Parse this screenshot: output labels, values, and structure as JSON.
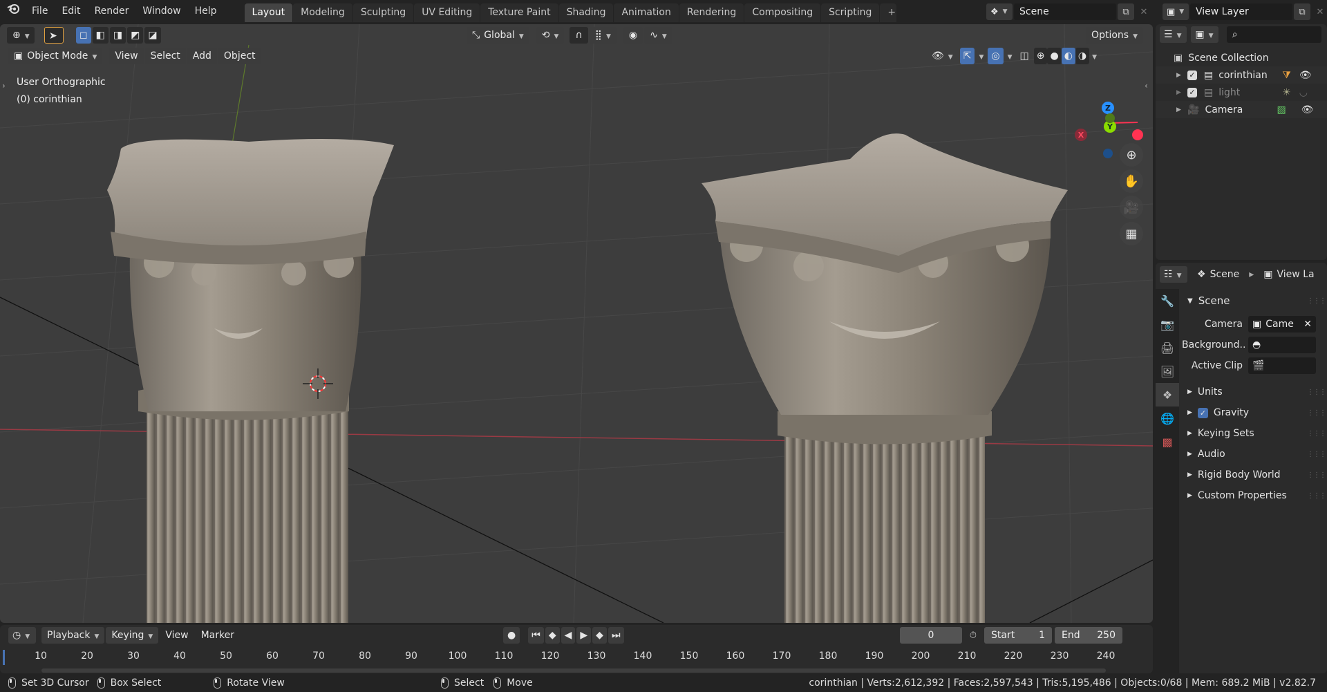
{
  "menu": [
    "File",
    "Edit",
    "Render",
    "Window",
    "Help"
  ],
  "workspaces": [
    "Layout",
    "Modeling",
    "Sculpting",
    "UV Editing",
    "Texture Paint",
    "Shading",
    "Animation",
    "Rendering",
    "Compositing",
    "Scripting"
  ],
  "active_workspace": "Layout",
  "scene_name": "Scene",
  "view_layer_name": "View Layer",
  "viewport": {
    "mode": "Object Mode",
    "menus": [
      "View",
      "Select",
      "Add",
      "Object"
    ],
    "transform_orientation": "Global",
    "options_label": "Options",
    "view_name": "User Orthographic",
    "active_object": "(0) corinthian",
    "gizmo": {
      "x": "X",
      "y": "Y",
      "z": "Z"
    }
  },
  "outliner": {
    "root": "Scene Collection",
    "items": [
      {
        "name": "corinthian",
        "checked": true,
        "dim": false
      },
      {
        "name": "light",
        "checked": true,
        "dim": true
      },
      {
        "name": "Camera",
        "checked": null,
        "dim": false
      }
    ]
  },
  "properties": {
    "breadcrumb_scene": "Scene",
    "breadcrumb_layer": "View La",
    "panel_title": "Scene",
    "camera_label": "Camera",
    "camera_value": "Came",
    "background_label": "Background..",
    "active_clip_label": "Active Clip",
    "sections": [
      "Units",
      "Gravity",
      "Keying Sets",
      "Audio",
      "Rigid Body World",
      "Custom Properties"
    ]
  },
  "timeline": {
    "menus": [
      "Playback",
      "Keying",
      "View",
      "Marker"
    ],
    "current_frame": "0",
    "start_label": "Start",
    "start_value": "1",
    "end_label": "End",
    "end_value": "250",
    "ticks": [
      "10",
      "20",
      "30",
      "40",
      "50",
      "60",
      "70",
      "80",
      "90",
      "100",
      "110",
      "120",
      "130",
      "140",
      "150",
      "160",
      "170",
      "180",
      "190",
      "200",
      "210",
      "220",
      "230",
      "240"
    ]
  },
  "status": {
    "left": [
      "Set 3D Cursor",
      "Box Select",
      "Rotate View",
      "Select",
      "Move"
    ],
    "right": "corinthian | Verts:2,612,392 | Faces:2,597,543 | Tris:5,195,486 | Objects:0/68 | Mem: 689.2 MiB | v2.82.7"
  },
  "colors": {
    "accent": "#4772b3",
    "axis_x": "#ff3352",
    "axis_y": "#8bdc00",
    "axis_z": "#2890ff"
  }
}
